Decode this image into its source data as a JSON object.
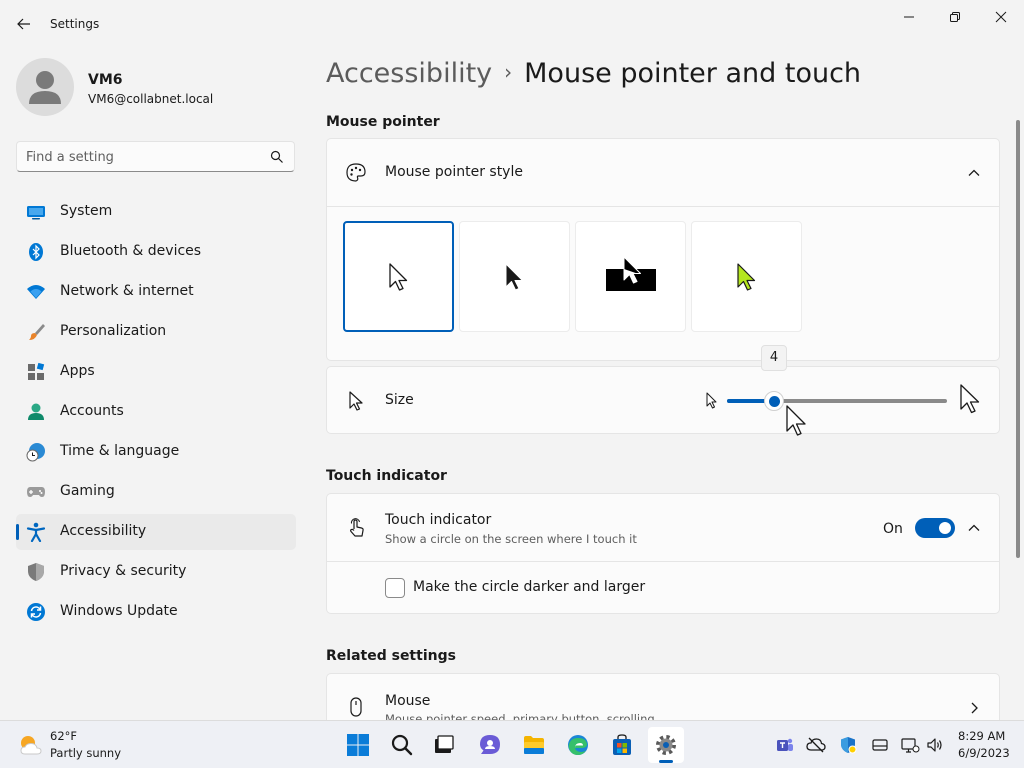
{
  "window": {
    "title": "Settings",
    "controls": [
      "minimize-icon",
      "restore-icon",
      "close-icon"
    ]
  },
  "user": {
    "name": "VM6",
    "email": "VM6@collabnet.local"
  },
  "search": {
    "placeholder": "Find a setting"
  },
  "nav": [
    {
      "label": "System",
      "icon": "system-icon"
    },
    {
      "label": "Bluetooth & devices",
      "icon": "bluetooth-icon"
    },
    {
      "label": "Network & internet",
      "icon": "wifi-icon"
    },
    {
      "label": "Personalization",
      "icon": "brush-icon"
    },
    {
      "label": "Apps",
      "icon": "apps-icon"
    },
    {
      "label": "Accounts",
      "icon": "accounts-icon"
    },
    {
      "label": "Time & language",
      "icon": "time-language-icon"
    },
    {
      "label": "Gaming",
      "icon": "gamepad-icon"
    },
    {
      "label": "Accessibility",
      "icon": "accessibility-icon",
      "active": true
    },
    {
      "label": "Privacy & security",
      "icon": "shield-icon"
    },
    {
      "label": "Windows Update",
      "icon": "update-icon"
    }
  ],
  "breadcrumb": {
    "parent": "Accessibility",
    "separator": "›",
    "current": "Mouse pointer and touch"
  },
  "mouse_pointer": {
    "section_title": "Mouse pointer",
    "style_label": "Mouse pointer style",
    "styles": [
      {
        "name": "white",
        "selected": true
      },
      {
        "name": "black",
        "selected": false
      },
      {
        "name": "inverted",
        "selected": false
      },
      {
        "name": "custom",
        "color": "#b4e61e",
        "selected": false
      }
    ],
    "size_label": "Size",
    "size_value": "4",
    "size_min": 1,
    "size_max": 15
  },
  "touch": {
    "section_title": "Touch indicator",
    "label": "Touch indicator",
    "description": "Show a circle on the screen where I touch it",
    "toggle_state": "On",
    "checkbox_label": "Make the circle darker and larger"
  },
  "related": {
    "section_title": "Related settings",
    "mouse_label": "Mouse",
    "mouse_desc": "Mouse pointer speed, primary button, scrolling"
  },
  "taskbar": {
    "weather_temp": "62°F",
    "weather_desc": "Partly sunny",
    "time": "8:29 AM",
    "date": "6/9/2023",
    "apps": [
      "windows-start-icon",
      "search-icon",
      "task-view-icon",
      "chat-icon",
      "file-explorer-icon",
      "edge-icon",
      "store-icon",
      "settings-icon"
    ],
    "tray": [
      "teams-icon",
      "cloud-offline-icon",
      "defender-icon",
      "display-icon",
      "network-icon",
      "volume-icon"
    ]
  },
  "colors": {
    "accent": "#005fb8",
    "background": "#f3f3f3",
    "card": "#fbfbfb"
  }
}
